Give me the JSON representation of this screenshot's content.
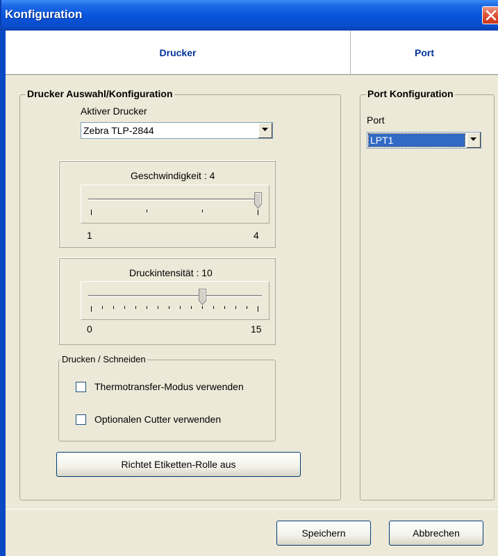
{
  "window": {
    "title": "Konfiguration"
  },
  "tabs": [
    {
      "label": "Drucker"
    },
    {
      "label": "Port"
    }
  ],
  "printer_group": {
    "title": "Drucker Auswahl/Konfiguration",
    "active_printer_label": "Aktiver Drucker",
    "active_printer_value": "Zebra TLP-2844",
    "speed": {
      "label": "Geschwindigkeit : 4",
      "min_label": "1",
      "max_label": "4",
      "min": 1,
      "max": 4,
      "value": 4
    },
    "intensity": {
      "label": "Druckintensität : 10",
      "min_label": "0",
      "max_label": "15",
      "min": 0,
      "max": 15,
      "value": 10
    },
    "print_cut": {
      "title": "Drucken / Schneiden",
      "thermo_label": "Thermotransfer-Modus verwenden",
      "thermo_checked": false,
      "cutter_label": "Optionalen Cutter verwenden",
      "cutter_checked": false
    },
    "align_button_label": "Richtet Etiketten-Rolle aus"
  },
  "port_group": {
    "title": "Port Konfiguration",
    "port_label": "Port",
    "port_value": "LPT1"
  },
  "footer": {
    "save_label": "Speichern",
    "cancel_label": "Abbrechen"
  },
  "colors": {
    "titlebar": "#0855DD",
    "tab_text": "#003399",
    "face": "#ECE9D8",
    "selection": "#316AC5"
  }
}
